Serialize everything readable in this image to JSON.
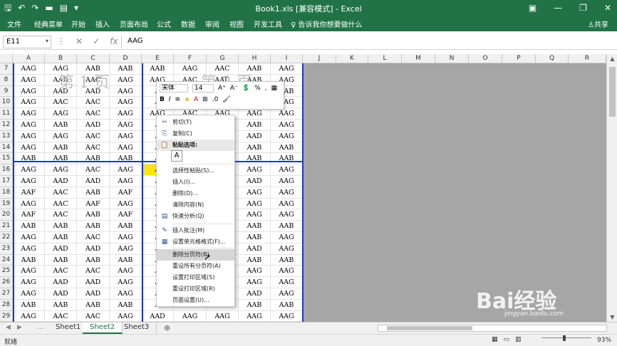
{
  "title": {
    "window_title": "Book1.xls  [兼容模式]  -  Excel",
    "qat": [
      "save-icon",
      "undo-icon",
      "redo-icon",
      "open-icon",
      "print-preview-icon",
      "customize-icon"
    ]
  },
  "tabs": [
    "文件",
    "经典菜单",
    "开始",
    "插入",
    "页面布局",
    "公式",
    "数据",
    "审阅",
    "视图",
    "开发工具",
    "告诉我你想要做什么"
  ],
  "share_label": "共享",
  "formula_bar": {
    "name_box": "E11",
    "fx": "fx",
    "value": "AAG"
  },
  "columns": [
    "A",
    "B",
    "C",
    "D",
    "E",
    "F",
    "G",
    "H",
    "I",
    "J",
    "K",
    "L",
    "M",
    "N",
    "O",
    "P",
    "Q",
    "R"
  ],
  "rows": [
    {
      "n": "7",
      "cells": [
        "AAG",
        "AAG",
        "AAB",
        "AAB",
        "AAB",
        "AAG",
        "AAC",
        "AAB",
        "AAG"
      ]
    },
    {
      "n": "8",
      "cells": [
        "AAG",
        "AAB",
        "AAC",
        "AAG",
        "AAG",
        "AAC",
        "AAD",
        "AAB",
        "AAG"
      ]
    },
    {
      "n": "9",
      "cells": [
        "AAG",
        "AAD",
        "AAD",
        "AAG",
        "A",
        "",
        "",
        "AAB",
        "AAB"
      ]
    },
    {
      "n": "10",
      "cells": [
        "AAG",
        "AAC",
        "AAC",
        "AAG",
        "A",
        "",
        "",
        "AAG",
        "AAG"
      ]
    },
    {
      "n": "11",
      "cells": [
        "AAG",
        "AAG",
        "AAC",
        "AAG",
        "AAG",
        "AAC",
        "AAG",
        "AAG",
        "AAG"
      ]
    },
    {
      "n": "12",
      "cells": [
        "AAG",
        "AAB",
        "AAD",
        "AAG",
        "A",
        "",
        "",
        "AAB",
        "AAG"
      ]
    },
    {
      "n": "13",
      "cells": [
        "AAG",
        "AAG",
        "AAC",
        "AAG",
        "A",
        "",
        "",
        "AAD",
        "AAG"
      ]
    },
    {
      "n": "14",
      "cells": [
        "AAG",
        "AAB",
        "AAC",
        "AAG",
        "A",
        "",
        "",
        "AAB",
        "AAB"
      ]
    },
    {
      "n": "15",
      "cells": [
        "AAB",
        "AAB",
        "AAB",
        "AAB",
        "A",
        "",
        "",
        "AAB",
        "AAB"
      ]
    },
    {
      "n": "16",
      "cells": [
        "AAG",
        "AAG",
        "AAC",
        "AAG",
        "A",
        "",
        "",
        "AAG",
        "AAG"
      ]
    },
    {
      "n": "17",
      "cells": [
        "AAG",
        "AAD",
        "AAD",
        "AAG",
        "A",
        "",
        "",
        "AAD",
        "AAG"
      ]
    },
    {
      "n": "18",
      "cells": [
        "AAF",
        "AAC",
        "AAB",
        "AAF",
        "A",
        "",
        "",
        "AAG",
        "AAG"
      ]
    },
    {
      "n": "19",
      "cells": [
        "AAG",
        "AAC",
        "AAF",
        "AAG",
        "A",
        "",
        "",
        "AAG",
        "AAG"
      ]
    },
    {
      "n": "20",
      "cells": [
        "AAF",
        "AAC",
        "AAB",
        "AAF",
        "A",
        "",
        "",
        "AAG",
        "AAG"
      ]
    },
    {
      "n": "21",
      "cells": [
        "AAB",
        "AAB",
        "AAB",
        "AAB",
        "A",
        "",
        "",
        "AAB",
        "AAB"
      ]
    },
    {
      "n": "22",
      "cells": [
        "AAG",
        "AAB",
        "AAC",
        "AAG",
        "A",
        "",
        "",
        "AAB",
        "AAG"
      ]
    },
    {
      "n": "23",
      "cells": [
        "AAG",
        "AAD",
        "AAD",
        "AAG",
        "A",
        "",
        "",
        "AAD",
        "AAG"
      ]
    },
    {
      "n": "24",
      "cells": [
        "AAB",
        "AAB",
        "AAB",
        "AAB",
        "A",
        "",
        "",
        "AAB",
        "AAB"
      ]
    },
    {
      "n": "25",
      "cells": [
        "AAG",
        "AAC",
        "AAC",
        "AAG",
        "A",
        "",
        "",
        "AAG",
        "AAG"
      ]
    },
    {
      "n": "26",
      "cells": [
        "AAG",
        "AAD",
        "AAD",
        "AAG",
        "A",
        "",
        "",
        "AAG",
        "AAG"
      ]
    },
    {
      "n": "27",
      "cells": [
        "AAG",
        "AAD",
        "AAD",
        "AAG",
        "A",
        "",
        "",
        "AAD",
        "AAG"
      ]
    },
    {
      "n": "28",
      "cells": [
        "AAB",
        "AAB",
        "AAB",
        "AAB",
        "A",
        "",
        "",
        "AAB",
        "AAB"
      ]
    },
    {
      "n": "29",
      "cells": [
        "AAG",
        "AAC",
        "AAC",
        "AAG",
        "AAD",
        "AAG",
        "AAG",
        "AAG",
        "AAG"
      ]
    }
  ],
  "page_watermarks": [
    "第 1 页",
    "第 2 页"
  ],
  "mini_toolbar": {
    "font": "宋体",
    "size": "14",
    "row2": [
      "B",
      "I"
    ]
  },
  "context_menu": {
    "items": [
      {
        "icon": "cut-icon",
        "label": "剪切(T)"
      },
      {
        "icon": "copy-icon",
        "label": "复制(C)"
      },
      {
        "icon": "paste-icon",
        "label": "粘贴选项:",
        "header": true
      },
      {
        "icon": "",
        "label": ""
      },
      {
        "icon": "",
        "label": "选择性粘贴(S)..."
      },
      {
        "icon": "",
        "label": "插入(I)..."
      },
      {
        "icon": "",
        "label": "删除(D)..."
      },
      {
        "icon": "",
        "label": "清除内容(N)"
      },
      {
        "icon": "quick-analysis-icon",
        "label": "快速分析(Q)"
      },
      {
        "icon": "comment-icon",
        "label": "插入批注(M)"
      },
      {
        "icon": "format-cells-icon",
        "label": "设置单元格格式(F)..."
      },
      {
        "icon": "",
        "label": "删除分页符(B)",
        "highlight": true
      },
      {
        "icon": "",
        "label": "重设所有分页符(A)"
      },
      {
        "icon": "",
        "label": "设置打印区域(S)"
      },
      {
        "icon": "",
        "label": "重设打印区域(R)"
      },
      {
        "icon": "",
        "label": "页面设置(U)..."
      }
    ]
  },
  "sheets": [
    "Sheet1",
    "Sheet2",
    "Sheet3"
  ],
  "active_sheet": "Sheet2",
  "status": {
    "ready": "就绪",
    "zoom": "93%"
  },
  "watermark": {
    "brand": "Bai经验",
    "url": "jingyan.baidu.com"
  },
  "colors": {
    "accent": "#217346",
    "page_break": "#1f36c9",
    "selected_cell": "#ffe600"
  }
}
